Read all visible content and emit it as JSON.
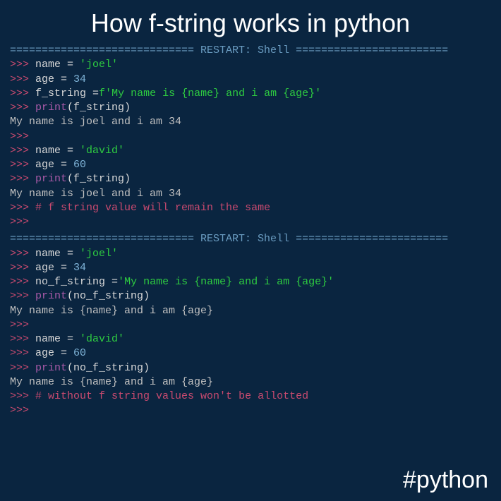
{
  "title": "How f-string works in python",
  "hashtag": "#python",
  "restart1": "============================= RESTART: Shell ========================",
  "restart2": "============================= RESTART: Shell ========================",
  "block1": {
    "l1_prompt": ">>> ",
    "l1_var": "name ",
    "l1_eq": "= ",
    "l1_str": "'joel'",
    "l2_prompt": ">>> ",
    "l2_var": "age ",
    "l2_eq": "= ",
    "l2_num": "34",
    "l3_prompt": ">>> ",
    "l3_var": "f_string ",
    "l3_eq": "=",
    "l3_f": "f",
    "l3_str": "'My name is {name} and i am {age}'",
    "l4_prompt": ">>> ",
    "l4_func": "print",
    "l4_open": "(",
    "l4_arg": "f_string",
    "l4_close": ")",
    "l5_output": "My name is joel and i am 34",
    "l6_prompt": ">>>",
    "l7_prompt": ">>> ",
    "l7_var": "name ",
    "l7_eq": "= ",
    "l7_str": "'david'",
    "l8_prompt": ">>> ",
    "l8_var": "age ",
    "l8_eq": "= ",
    "l8_num": "60",
    "l9_prompt": ">>> ",
    "l9_func": "print",
    "l9_open": "(",
    "l9_arg": "f_string",
    "l9_close": ")",
    "l10_output": "My name is joel and i am 34",
    "l11_prompt": ">>> ",
    "l11_comment": "# f string value will remain the same",
    "l12_prompt": ">>>"
  },
  "block2": {
    "l1_prompt": ">>> ",
    "l1_var": "name ",
    "l1_eq": "= ",
    "l1_str": "'joel'",
    "l2_prompt": ">>> ",
    "l2_var": "age ",
    "l2_eq": "= ",
    "l2_num": "34",
    "l3_prompt": ">>> ",
    "l3_var": "no_f_string ",
    "l3_eq": "=",
    "l3_str": "'My name is {name} and i am {age}'",
    "l4_prompt": ">>> ",
    "l4_func": "print",
    "l4_open": "(",
    "l4_arg": "no_f_string",
    "l4_close": ")",
    "l5_output": "My name is {name} and i am {age}",
    "l6_prompt": ">>>",
    "l7_prompt": ">>> ",
    "l7_var": "name ",
    "l7_eq": "= ",
    "l7_str": "'david'",
    "l8_prompt": ">>> ",
    "l8_var": "age ",
    "l8_eq": "= ",
    "l8_num": "60",
    "l9_prompt": ">>> ",
    "l9_func": "print",
    "l9_open": "(",
    "l9_arg": "no_f_string",
    "l9_close": ")",
    "l10_output": "My name is {name} and i am {age}",
    "l11_prompt": ">>> ",
    "l11_comment": "# without f string values won't be allotted",
    "l12_prompt": ">>>"
  }
}
